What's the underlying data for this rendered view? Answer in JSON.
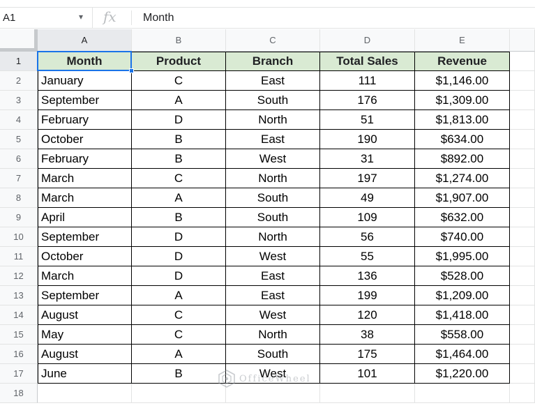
{
  "formula_bar": {
    "name_box": "A1",
    "caret": "▾",
    "fx_label": "fx",
    "value": "Month"
  },
  "columns": [
    "A",
    "B",
    "C",
    "D",
    "E"
  ],
  "active_column": "A",
  "active_row": "1",
  "row_numbers": [
    "1",
    "2",
    "3",
    "4",
    "5",
    "6",
    "7",
    "8",
    "9",
    "10",
    "11",
    "12",
    "13",
    "14",
    "15",
    "16",
    "17",
    "18"
  ],
  "table": {
    "header": [
      "Month",
      "Product",
      "Branch",
      "Total Sales",
      "Revenue"
    ],
    "header_fill": "#d9ead3",
    "rows": [
      [
        "January",
        "C",
        "East",
        "111",
        "$1,146.00"
      ],
      [
        "September",
        "A",
        "South",
        "176",
        "$1,309.00"
      ],
      [
        "February",
        "D",
        "North",
        "51",
        "$1,813.00"
      ],
      [
        "October",
        "B",
        "East",
        "190",
        "$634.00"
      ],
      [
        "February",
        "B",
        "West",
        "31",
        "$892.00"
      ],
      [
        "March",
        "C",
        "North",
        "197",
        "$1,274.00"
      ],
      [
        "March",
        "A",
        "South",
        "49",
        "$1,907.00"
      ],
      [
        "April",
        "B",
        "South",
        "109",
        "$632.00"
      ],
      [
        "September",
        "D",
        "North",
        "56",
        "$740.00"
      ],
      [
        "October",
        "D",
        "West",
        "55",
        "$1,995.00"
      ],
      [
        "March",
        "D",
        "East",
        "136",
        "$528.00"
      ],
      [
        "September",
        "A",
        "East",
        "199",
        "$1,209.00"
      ],
      [
        "August",
        "C",
        "West",
        "120",
        "$1,418.00"
      ],
      [
        "May",
        "C",
        "North",
        "38",
        "$558.00"
      ],
      [
        "August",
        "A",
        "South",
        "175",
        "$1,464.00"
      ],
      [
        "June",
        "B",
        "West",
        "101",
        "$1,220.00"
      ]
    ]
  },
  "watermark": {
    "text": "OfficeWheel",
    "icon": "officewheel-logo-icon"
  },
  "colors": {
    "selection": "#1a73e8",
    "header_fill": "#d9ead3"
  }
}
